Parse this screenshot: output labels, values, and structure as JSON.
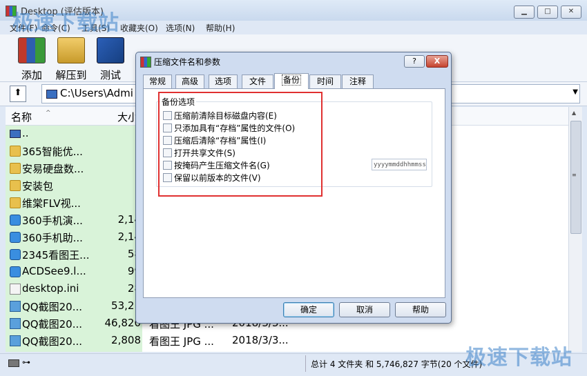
{
  "window": {
    "title": "Desktop (评估版本)",
    "minimize_glyph": "▁",
    "restore_glyph": "□",
    "close_glyph": "✕"
  },
  "menu": [
    "文件(F)",
    "命令(C)",
    "工具(S)",
    "收藏夹(O)",
    "选项(N)",
    "帮助(H)"
  ],
  "toolbar": {
    "buttons": [
      {
        "label": "添加",
        "icon": "add-archive-icon"
      },
      {
        "label": "解压到",
        "icon": "extract-to-icon"
      },
      {
        "label": "测试",
        "icon": "test-icon"
      }
    ]
  },
  "address": {
    "path": "C:\\Users\\Admi",
    "up_glyph": "⬆",
    "dropdown_glyph": "▼"
  },
  "filelist": {
    "headers": {
      "name": "名称",
      "size": "大小"
    },
    "sort_glyph": "^",
    "rows": [
      {
        "name": "..",
        "size": "",
        "type": "",
        "date": "",
        "icon": "parent-folder-icon"
      },
      {
        "name": "365智能优...",
        "size": "",
        "type": "",
        "date": "",
        "icon": "folder-icon"
      },
      {
        "name": "安易硬盘数...",
        "size": "",
        "type": "",
        "date": "",
        "icon": "folder-icon"
      },
      {
        "name": "安装包",
        "size": "",
        "type": "",
        "date": "",
        "icon": "folder-icon"
      },
      {
        "name": "维棠FLV视...",
        "size": "",
        "type": "",
        "date": "",
        "icon": "folder-icon"
      },
      {
        "name": "360手机演...",
        "size": "2,14",
        "type": "",
        "date": "",
        "icon": "app-icon"
      },
      {
        "name": "360手机助...",
        "size": "2,14",
        "type": "",
        "date": "",
        "icon": "app-icon"
      },
      {
        "name": "2345看图王...",
        "size": "58",
        "type": "",
        "date": "",
        "icon": "app-icon"
      },
      {
        "name": "ACDSee9.l...",
        "size": "99",
        "type": "",
        "date": "",
        "icon": "app-icon"
      },
      {
        "name": "desktop.ini",
        "size": "28",
        "type": "",
        "date": "",
        "icon": "ini-file-icon"
      },
      {
        "name": "QQ截图20...",
        "size": "53,21",
        "type": "",
        "date": "",
        "icon": "jpg-file-icon"
      },
      {
        "name": "QQ截图20...",
        "size": "46,820",
        "type": "看图王 JPG ...",
        "date": "2018/3/3...",
        "icon": "jpg-file-icon"
      },
      {
        "name": "QQ截图20...",
        "size": "2,808",
        "type": "看图王 JPG ...",
        "date": "2018/3/3...",
        "icon": "jpg-file-icon"
      }
    ]
  },
  "statusbar": {
    "key_glyph": "⊶",
    "summary": "总计 4 文件夹 和 5,746,827 字节(20 个文件)"
  },
  "dialog": {
    "title": "压缩文件名和参数",
    "help_glyph": "?",
    "close_glyph": "X",
    "tabs": [
      "常规",
      "高级",
      "选项",
      "文件",
      "备份",
      "时间",
      "注释"
    ],
    "active_tab": "备份",
    "group_label": "备份选项",
    "options": [
      {
        "label": "压缩前清除目标磁盘内容(E)",
        "checked": false
      },
      {
        "label": "只添加具有“存档”属性的文件(O)",
        "checked": false
      },
      {
        "label": "压缩后清除“存档”属性(I)",
        "checked": false
      },
      {
        "label": "打开共享文件(S)",
        "checked": false
      },
      {
        "label": "按掩码产生压缩文件名(G)",
        "checked": false
      },
      {
        "label": "保留以前版本的文件(V)",
        "checked": false
      }
    ],
    "mask_value": "yyyymmddhhmmss",
    "buttons": {
      "ok": "确定",
      "cancel": "取消",
      "help": "帮助"
    }
  },
  "watermark": "极速下载站",
  "colors": {
    "highlight": "#e03030",
    "list_highlight": "#d9f3d9",
    "accent": "#3c7fb1"
  }
}
